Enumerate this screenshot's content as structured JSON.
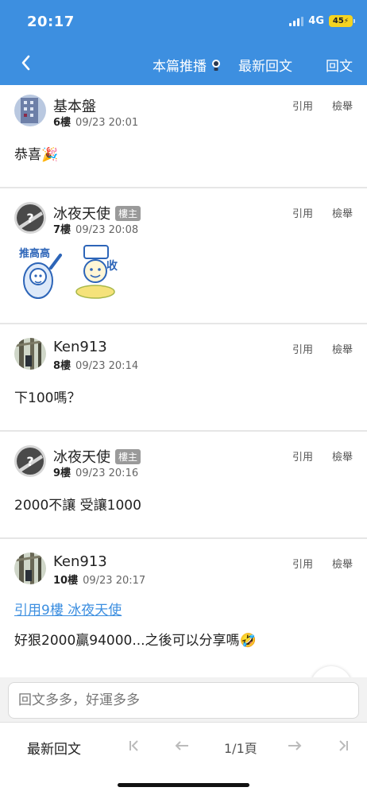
{
  "status": {
    "time": "20:17",
    "network": "4G",
    "battery": "45"
  },
  "nav": {
    "push_label": "本篇推播",
    "latest_label": "最新回文",
    "reply_label": "回文"
  },
  "post_actions": {
    "quote": "引用",
    "report": "檢舉"
  },
  "op_badge": "樓主",
  "posts": [
    {
      "author": "基本盤",
      "floor": "6樓",
      "time": "09/23 20:01",
      "content": "恭喜",
      "emoji": "🎉"
    },
    {
      "author": "冰夜天使",
      "floor": "7樓",
      "time": "09/23 20:08",
      "is_op": true,
      "stickers": [
        "推高高",
        "收"
      ]
    },
    {
      "author": "Ken913",
      "floor": "8樓",
      "time": "09/23 20:14",
      "content": "下100嗎？"
    },
    {
      "author": "冰夜天使",
      "floor": "9樓",
      "time": "09/23 20:16",
      "is_op": true,
      "content": "2000不讓 受讓1000"
    },
    {
      "author": "Ken913",
      "floor": "10樓",
      "time": "09/23 20:17",
      "quote": "引用9樓 冰夜天使",
      "content": "好狠2000贏94000...之後可以分享嗎",
      "emoji": "🤣"
    }
  ],
  "composer": {
    "placeholder": "回文多多，好運多多"
  },
  "bottom": {
    "latest_label": "最新回文",
    "page_label": "1/1頁"
  },
  "colors": {
    "brand_blue": "#3d8fe0",
    "battery_yellow": "#f5d320",
    "badge_gray": "#9a9a9a"
  },
  "icons": [
    "chevron-left-icon",
    "bulb-icon",
    "scroll-top-icon",
    "first-page-icon",
    "prev-page-icon",
    "next-page-icon",
    "last-page-icon"
  ]
}
